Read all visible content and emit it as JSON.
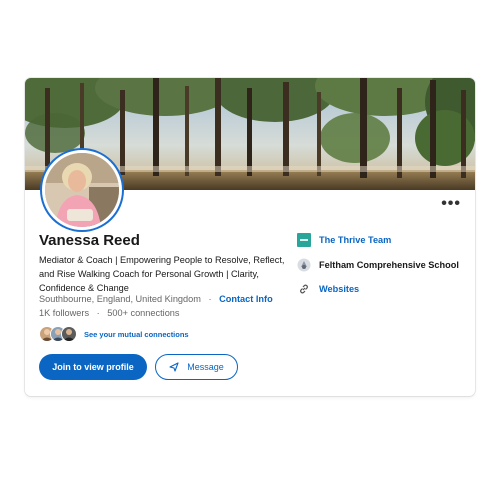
{
  "profile": {
    "name": "Vanessa Reed",
    "headline": "Mediator & Coach | Empowering People to Resolve, Reflect, and Rise Walking Coach for Personal Growth | Clarity, Confidence & Change",
    "location": "Southbourne, England, United Kingdom",
    "contact_info_label": "Contact Info",
    "followers": "1K followers",
    "connections": "500+ connections",
    "mutual_label": "See your mutual connections"
  },
  "actions": {
    "join_label": "Join to view profile",
    "message_label": "Message"
  },
  "sidebar": {
    "company": "The Thrive Team",
    "school": "Feltham Comprehensive School",
    "websites": "Websites"
  },
  "colors": {
    "accent": "#0a66c2",
    "company_logo": "#2aa59a"
  },
  "icons": {
    "more": "more-horizontal-icon",
    "message": "send-icon",
    "company": "company-logo-icon",
    "school": "school-logo-icon",
    "websites": "link-icon"
  }
}
